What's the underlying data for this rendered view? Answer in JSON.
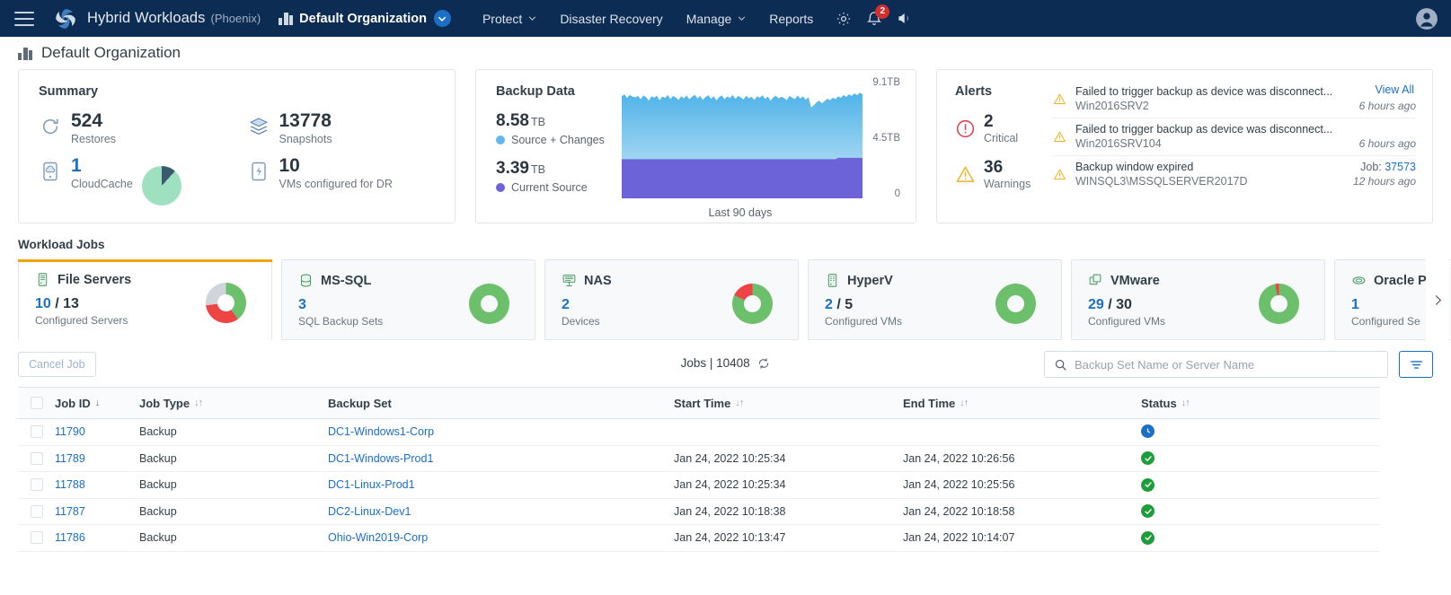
{
  "topnav": {
    "menu_icon": "hamburger-icon",
    "logo_icon": "druva-logo-icon",
    "app_title": "Hybrid Workloads",
    "app_sub": "(Phoenix)",
    "org_icon": "organization-icon",
    "org_name": "Default Organization",
    "org_caret_icon": "chevron-down-icon",
    "items": [
      {
        "label": "Protect",
        "has_caret": true
      },
      {
        "label": "Disaster Recovery",
        "has_caret": false
      },
      {
        "label": "Manage",
        "has_caret": true
      },
      {
        "label": "Reports",
        "has_caret": false
      }
    ],
    "settings_icon": "gear-icon",
    "notifications_icon": "bell-icon",
    "notifications_count": "2",
    "announcements_icon": "megaphone-icon",
    "avatar_icon": "user-avatar-icon"
  },
  "page": {
    "icon": "organization-icon",
    "title": "Default Organization"
  },
  "summary": {
    "title": "Summary",
    "cells": [
      {
        "icon": "restore-icon",
        "value": "524",
        "label": "Restores",
        "blue": false
      },
      {
        "icon": "snapshots-icon",
        "value": "13778",
        "label": "Snapshots",
        "blue": false
      },
      {
        "icon": "cloudcache-icon",
        "value": "1",
        "label": "CloudCache",
        "blue": true
      },
      {
        "icon": "dr-vm-icon",
        "value": "10",
        "label": "VMs configured for DR",
        "blue": false
      }
    ],
    "pie": {
      "name": "cloudcache-usage-pie",
      "used_pct": 12,
      "used_color": "#3c5a6e",
      "free_color": "#9fe0c0"
    }
  },
  "backup_data": {
    "title": "Backup Data",
    "stats": [
      {
        "value": "8.58",
        "unit": "TB",
        "label": "Source + Changes",
        "color": "#5fb8e8"
      },
      {
        "value": "3.39",
        "unit": "TB",
        "label": "Current Source",
        "color": "#6c63d8"
      }
    ],
    "caption": "Last 90 days",
    "axis": {
      "top": "9.1TB",
      "mid": "4.5TB",
      "bottom": "0"
    }
  },
  "chart_data": {
    "type": "area",
    "title": "Backup Data",
    "xlabel": "Last 90 days",
    "ylabel": "",
    "ylim": [
      0,
      9.1
    ],
    "yticks": [
      0,
      4.5,
      9.1
    ],
    "ytick_labels": [
      "0",
      "4.5TB",
      "9.1TB"
    ],
    "grid": false,
    "legend_position": "left",
    "series": [
      {
        "name": "Source + Changes",
        "color": "#5fb8e8",
        "current_value": 8.58,
        "unit": "TB",
        "values": [
          8.55,
          8.72,
          8.4,
          8.68,
          8.52,
          8.46,
          8.58,
          8.3,
          8.62,
          8.48,
          8.18,
          8.56,
          8.44,
          8.6,
          8.22,
          8.54,
          8.4,
          8.66,
          8.32,
          8.58,
          8.44,
          8.24,
          8.56,
          8.38,
          8.62,
          8.3,
          8.52,
          8.68,
          8.36,
          8.58,
          8.26,
          8.5,
          8.64,
          8.34,
          8.56,
          8.2,
          8.48,
          8.62,
          8.3,
          8.54,
          8.4,
          8.66,
          8.34,
          8.58,
          8.46,
          8.28,
          8.6,
          8.38,
          8.52,
          8.24,
          8.56,
          8.42,
          8.64,
          8.32,
          8.54,
          8.18,
          8.46,
          8.6,
          8.36,
          8.52,
          8.4,
          8.22,
          8.58,
          8.44,
          8.3,
          8.62,
          8.36,
          8.54,
          8.26,
          8.48,
          7.62,
          7.8,
          8.05,
          8.2,
          7.95,
          8.15,
          8.35,
          8.22,
          8.44,
          8.3,
          8.56,
          8.42,
          8.66,
          8.5,
          8.72,
          8.58,
          8.8,
          8.64,
          8.86,
          8.72
        ]
      },
      {
        "name": "Current Source",
        "color": "#6c63d8",
        "current_value": 3.39,
        "unit": "TB",
        "values": [
          3.28,
          3.28,
          3.28,
          3.28,
          3.28,
          3.28,
          3.28,
          3.28,
          3.28,
          3.28,
          3.28,
          3.28,
          3.28,
          3.28,
          3.28,
          3.28,
          3.28,
          3.28,
          3.28,
          3.28,
          3.28,
          3.28,
          3.28,
          3.28,
          3.28,
          3.28,
          3.28,
          3.28,
          3.28,
          3.28,
          3.28,
          3.28,
          3.28,
          3.28,
          3.28,
          3.28,
          3.28,
          3.28,
          3.28,
          3.28,
          3.28,
          3.28,
          3.28,
          3.28,
          3.28,
          3.28,
          3.28,
          3.28,
          3.28,
          3.28,
          3.28,
          3.28,
          3.28,
          3.28,
          3.28,
          3.28,
          3.28,
          3.28,
          3.28,
          3.28,
          3.28,
          3.28,
          3.28,
          3.28,
          3.28,
          3.28,
          3.28,
          3.28,
          3.28,
          3.28,
          3.28,
          3.28,
          3.28,
          3.28,
          3.28,
          3.28,
          3.28,
          3.28,
          3.28,
          3.28,
          3.39,
          3.39,
          3.39,
          3.39,
          3.39,
          3.39,
          3.39,
          3.39,
          3.39,
          3.39
        ]
      }
    ]
  },
  "alerts": {
    "title": "Alerts",
    "view_all": "View All",
    "stats": [
      {
        "icon": "critical-icon",
        "value": "2",
        "label": "Critical"
      },
      {
        "icon": "warning-icon",
        "value": "36",
        "label": "Warnings"
      }
    ],
    "rows": [
      {
        "icon": "warning-icon",
        "message": "Failed to trigger backup as device was disconnect...",
        "source": "Win2016SRV2",
        "job_prefix": "",
        "job_id": "",
        "time": "6 hours ago"
      },
      {
        "icon": "warning-icon",
        "message": "Failed to trigger backup as device was disconnect...",
        "source": "Win2016SRV104",
        "job_prefix": "",
        "job_id": "",
        "time": "6 hours ago"
      },
      {
        "icon": "warning-icon",
        "message": "Backup window expired",
        "source": "WINSQL3\\MSSQLSERVER2017D",
        "job_prefix": "Job: ",
        "job_id": "37573",
        "time": "12 hours ago"
      }
    ]
  },
  "workload": {
    "title": "Workload Jobs",
    "next_icon": "chevron-right-icon",
    "tabs": [
      {
        "icon": "file-server-icon",
        "name": "File Servers",
        "num": "10",
        "den": " / 13",
        "sub": "Configured Servers",
        "active": true,
        "donut": {
          "green": 40,
          "red": 33,
          "gray": 27
        }
      },
      {
        "icon": "database-icon",
        "name": "MS-SQL",
        "num": "3",
        "den": "",
        "sub": "SQL Backup Sets",
        "active": false,
        "donut": {
          "green": 100,
          "red": 0,
          "gray": 0
        }
      },
      {
        "icon": "nas-icon",
        "name": "NAS",
        "num": "2",
        "den": "",
        "sub": "Devices",
        "active": false,
        "donut": {
          "green": 82,
          "red": 18,
          "gray": 0
        }
      },
      {
        "icon": "hyperv-icon",
        "name": "HyperV",
        "num": "2",
        "den": " / 5",
        "sub": "Configured VMs",
        "active": false,
        "donut": {
          "green": 100,
          "red": 0,
          "gray": 0
        }
      },
      {
        "icon": "vmware-icon",
        "name": "VMware",
        "num": "29",
        "den": " / 30",
        "sub": "Configured VMs",
        "active": false,
        "donut": {
          "green": 97,
          "red": 3,
          "gray": 0
        }
      },
      {
        "icon": "oracle-icon",
        "name": "Oracle P",
        "num": "1",
        "den": "",
        "sub": "Configured Se",
        "active": false,
        "donut": {
          "green": 100,
          "red": 0,
          "gray": 0
        }
      }
    ],
    "donut_colors": {
      "green": "#6cc06c",
      "red": "#ef4444",
      "gray": "#cfd5db"
    }
  },
  "toolbar": {
    "cancel_label": "Cancel Job",
    "jobs_label": "Jobs | 10408",
    "refresh_icon": "refresh-icon",
    "search_icon": "search-icon",
    "search_placeholder": "Backup Set Name or Server Name",
    "search_value": "",
    "filter_icon": "filter-icon"
  },
  "table": {
    "select_all_checkbox": "select-all-checkbox",
    "columns": [
      {
        "key": "job_id",
        "label": "Job ID",
        "sort": "down"
      },
      {
        "key": "job_type",
        "label": "Job Type",
        "sort": "both"
      },
      {
        "key": "backup_set",
        "label": "Backup Set",
        "sort": "none"
      },
      {
        "key": "start_time",
        "label": "Start Time",
        "sort": "both"
      },
      {
        "key": "end_time",
        "label": "End Time",
        "sort": "both"
      },
      {
        "key": "status",
        "label": "Status",
        "sort": "both"
      }
    ],
    "rows": [
      {
        "job_id": "11790",
        "job_type": "Backup",
        "backup_set": "DC1-Windows1-Corp",
        "start_time": "",
        "end_time": "",
        "status": "queued",
        "status_icon": "clock-icon"
      },
      {
        "job_id": "11789",
        "job_type": "Backup",
        "backup_set": "DC1-Windows-Prod1",
        "start_time": "Jan 24, 2022 10:25:34",
        "end_time": "Jan 24, 2022 10:26:56",
        "status": "success",
        "status_icon": "check-circle-icon"
      },
      {
        "job_id": "11788",
        "job_type": "Backup",
        "backup_set": "DC1-Linux-Prod1",
        "start_time": "Jan 24, 2022 10:25:34",
        "end_time": "Jan 24, 2022 10:25:56",
        "status": "success",
        "status_icon": "check-circle-icon"
      },
      {
        "job_id": "11787",
        "job_type": "Backup",
        "backup_set": "DC2-Linux-Dev1",
        "start_time": "Jan 24, 2022 10:18:38",
        "end_time": "Jan 24, 2022 10:18:58",
        "status": "success",
        "status_icon": "check-circle-icon"
      },
      {
        "job_id": "11786",
        "job_type": "Backup",
        "backup_set": "Ohio-Win2019-Corp",
        "start_time": "Jan 24, 2022 10:13:47",
        "end_time": "Jan 24, 2022 10:14:07",
        "status": "success",
        "status_icon": "check-circle-icon"
      }
    ],
    "status_colors": {
      "success": "#1f9d3a",
      "queued": "#1b6fc4"
    }
  }
}
